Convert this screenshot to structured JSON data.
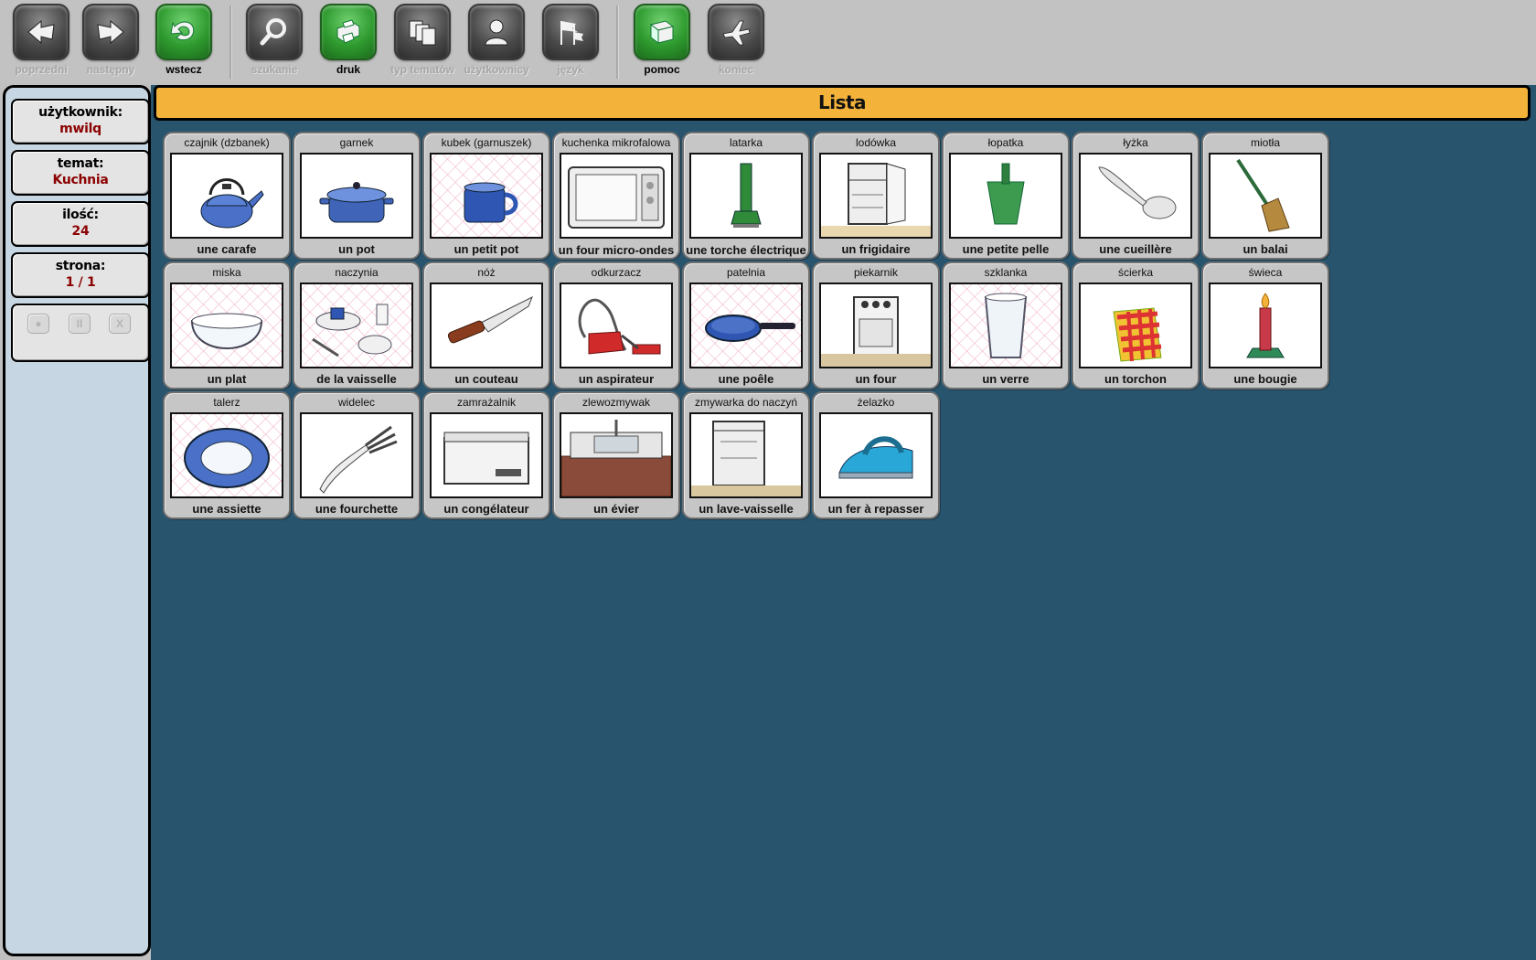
{
  "toolbar": {
    "buttons": [
      {
        "label": "poprzedni",
        "icon": "arrow-left-icon",
        "enabled": false
      },
      {
        "label": "następny",
        "icon": "arrow-right-icon",
        "enabled": false
      },
      {
        "label": "wstecz",
        "icon": "undo-icon",
        "enabled": true
      },
      {
        "label": "szukanie",
        "icon": "magnifier-icon",
        "enabled": false
      },
      {
        "label": "druk",
        "icon": "printer-icon",
        "enabled": true
      },
      {
        "label": "typ tematów",
        "icon": "cards-icon",
        "enabled": false
      },
      {
        "label": "użytkownicy",
        "icon": "user-icon",
        "enabled": false
      },
      {
        "label": "język",
        "icon": "flags-icon",
        "enabled": false
      },
      {
        "label": "pomoc",
        "icon": "book-icon",
        "enabled": true
      },
      {
        "label": "koniec",
        "icon": "airplane-icon",
        "enabled": false
      }
    ]
  },
  "sidebar": {
    "user": {
      "label": "użytkownik:",
      "value": "mwilq"
    },
    "topic": {
      "label": "temat:",
      "value": "Kuchnia"
    },
    "count": {
      "label": "ilość:",
      "value": "24"
    },
    "page": {
      "label": "strona:",
      "value": "1 / 1"
    },
    "controls": [
      {
        "name": "record-icon",
        "glyph": "●"
      },
      {
        "name": "pause-icon",
        "glyph": "II"
      },
      {
        "name": "stop-icon",
        "glyph": "X"
      }
    ]
  },
  "main": {
    "title": "Lista",
    "items": [
      {
        "pl": "czajnik (dzbanek)",
        "fr": "une carafe",
        "pic": "kettle",
        "bg": "plain"
      },
      {
        "pl": "garnek",
        "fr": "un pot",
        "pic": "pot",
        "bg": "plain"
      },
      {
        "pl": "kubek (garnuszek)",
        "fr": "un petit pot",
        "pic": "mug",
        "bg": "checked"
      },
      {
        "pl": "kuchenka mikrofalowa",
        "fr": "un four micro-ondes",
        "pic": "microwave",
        "bg": "plain"
      },
      {
        "pl": "latarka",
        "fr": "une torche électrique",
        "pic": "flashlight",
        "bg": "plain"
      },
      {
        "pl": "lodówka",
        "fr": "un frigidaire",
        "pic": "fridge",
        "bg": "plain"
      },
      {
        "pl": "łopatka",
        "fr": "une petite pelle",
        "pic": "dustpan",
        "bg": "plain"
      },
      {
        "pl": "łyżka",
        "fr": "une cueillère",
        "pic": "spoon",
        "bg": "plain"
      },
      {
        "pl": "miotła",
        "fr": "un balai",
        "pic": "broom",
        "bg": "plain"
      },
      {
        "pl": "miska",
        "fr": "un plat",
        "pic": "bowl",
        "bg": "checked"
      },
      {
        "pl": "naczynia",
        "fr": "de la vaisselle",
        "pic": "dishes",
        "bg": "checked"
      },
      {
        "pl": "nóż",
        "fr": "un couteau",
        "pic": "knife",
        "bg": "plain"
      },
      {
        "pl": "odkurzacz",
        "fr": "un aspirateur",
        "pic": "vacuum",
        "bg": "plain"
      },
      {
        "pl": "patelnia",
        "fr": "une poêle",
        "pic": "pan",
        "bg": "checked"
      },
      {
        "pl": "piekarnik",
        "fr": "un four",
        "pic": "oven",
        "bg": "plain"
      },
      {
        "pl": "szklanka",
        "fr": "un verre",
        "pic": "glass",
        "bg": "checked"
      },
      {
        "pl": "ścierka",
        "fr": "un torchon",
        "pic": "cloth",
        "bg": "plain"
      },
      {
        "pl": "świeca",
        "fr": "une bougie",
        "pic": "candle",
        "bg": "plain"
      },
      {
        "pl": "talerz",
        "fr": "une assiette",
        "pic": "plate",
        "bg": "checked"
      },
      {
        "pl": "widelec",
        "fr": "une fourchette",
        "pic": "fork",
        "bg": "plain"
      },
      {
        "pl": "zamrażalnik",
        "fr": "un congélateur",
        "pic": "freezer",
        "bg": "plain"
      },
      {
        "pl": "zlewozmywak",
        "fr": "un évier",
        "pic": "sink",
        "bg": "plain"
      },
      {
        "pl": "zmywarka do naczyń",
        "fr": "un lave-vaisselle",
        "pic": "dishwasher",
        "bg": "plain"
      },
      {
        "pl": "żelazko",
        "fr": "un fer à repasser",
        "pic": "iron",
        "bg": "plain"
      }
    ]
  },
  "colors": {
    "toolbar_bg": "#c2c2c2",
    "sidebar_bg": "#c6d6e2",
    "main_bg": "#28546e",
    "title_bar": "#f3b33b",
    "sidebar_value": "#8b0000",
    "card_bg": "#c6c6c6"
  }
}
